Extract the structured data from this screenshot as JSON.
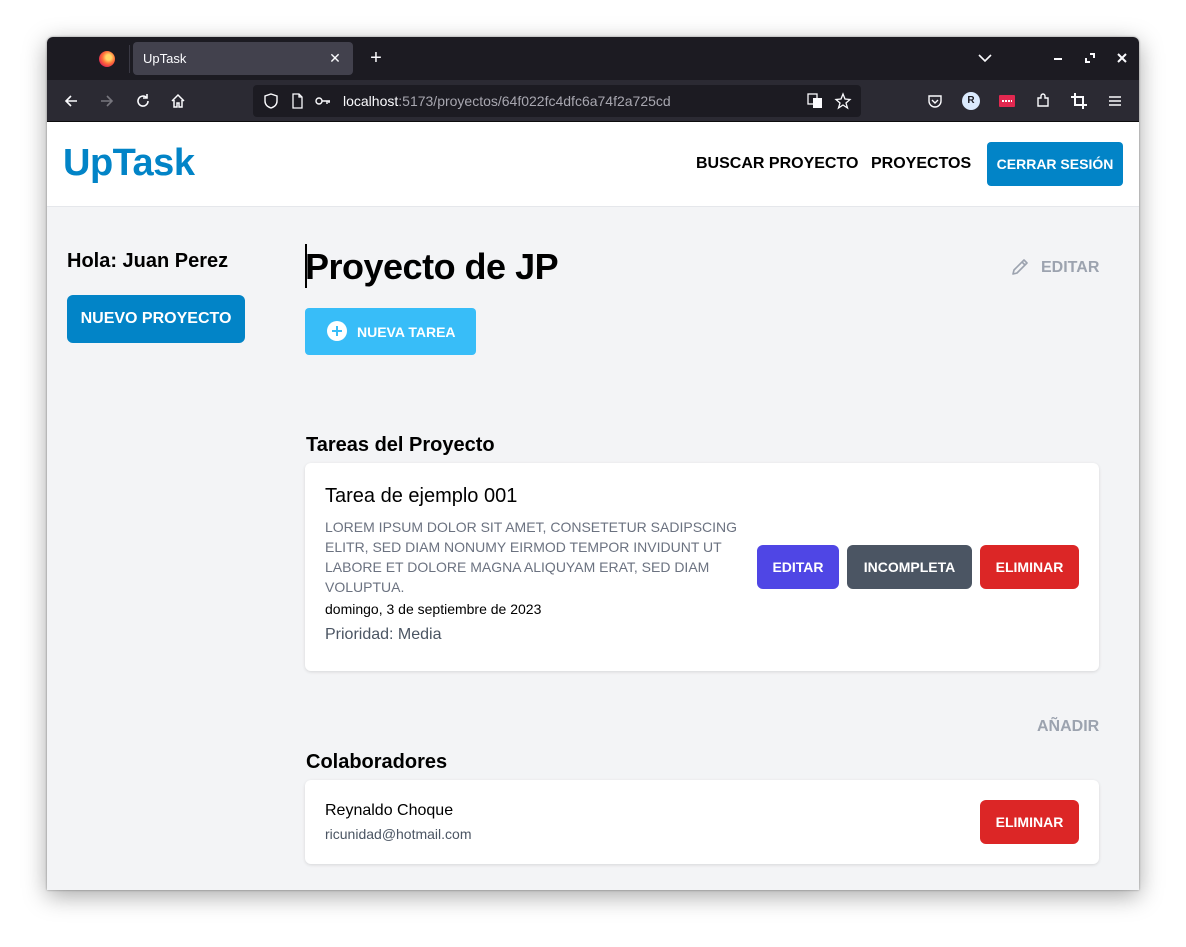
{
  "browser": {
    "tab_title": "UpTask",
    "url_host": "localhost",
    "url_path": ":5173/proyectos/64f022fc4dfc6a74f2a725cd",
    "extension_badge": "R"
  },
  "header": {
    "logo": "UpTask",
    "nav": [
      "BUSCAR PROYECTO",
      "PROYECTOS"
    ],
    "logout_label": "CERRAR SESIÓN"
  },
  "sidebar": {
    "greeting": "Hola: Juan Perez",
    "new_project_label": "NUEVO PROYECTO"
  },
  "project": {
    "title": "Proyecto de JP",
    "edit_label": "EDITAR",
    "new_task_label": "NUEVA TAREA"
  },
  "tasks": {
    "section_title": "Tareas del Proyecto",
    "items": [
      {
        "name": "Tarea de ejemplo 001",
        "description": "LOREM IPSUM DOLOR SIT AMET, CONSETETUR SADIPSCING ELITR, SED DIAM NONUMY EIRMOD TEMPOR INVIDUNT UT LABORE ET DOLORE MAGNA ALIQUYAM ERAT, SED DIAM VOLUPTUA.",
        "date": "domingo, 3 de septiembre de 2023",
        "priority": "Prioridad: Media",
        "edit_label": "EDITAR",
        "status_label": "INCOMPLETA",
        "delete_label": "ELIMINAR"
      }
    ]
  },
  "collaborators": {
    "section_title": "Colaboradores",
    "add_label": "AÑADIR",
    "items": [
      {
        "name": "Reynaldo Choque",
        "email": "ricunidad@hotmail.com",
        "delete_label": "ELIMINAR"
      }
    ]
  },
  "colors": {
    "brand": "#0284c7",
    "new_task": "#38bdf8",
    "edit": "#4f46e5",
    "incomplete": "#4b5563",
    "delete": "#dc2626"
  }
}
